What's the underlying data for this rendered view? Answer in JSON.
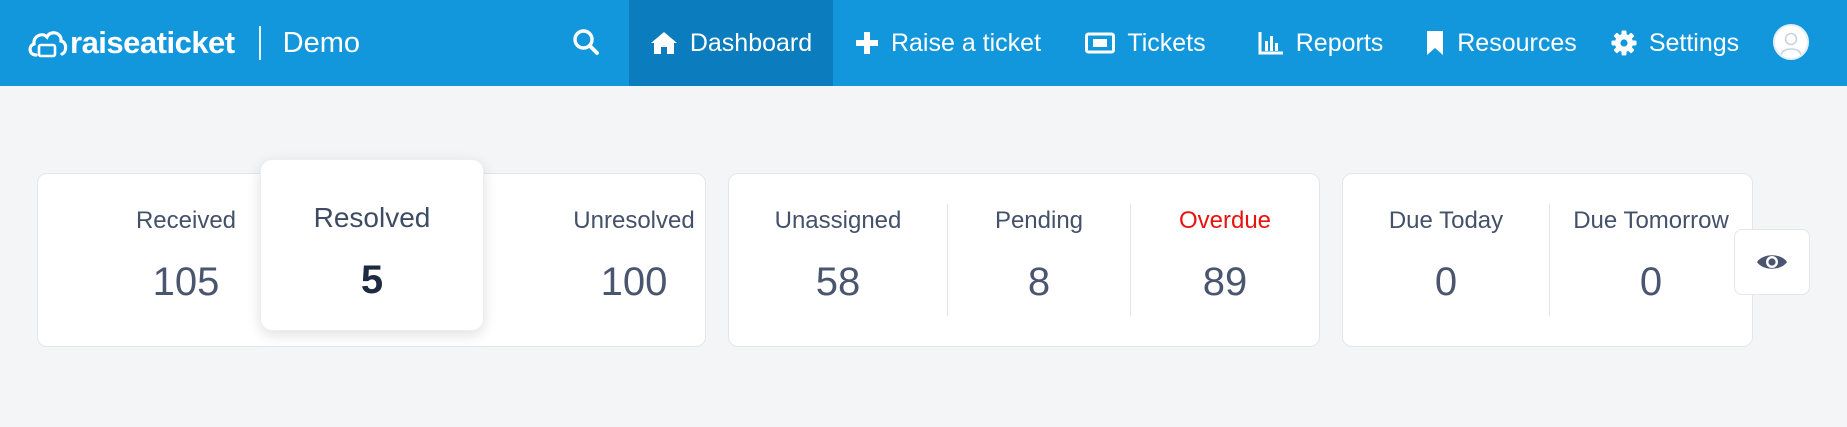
{
  "brand": {
    "name": "raiseaticket",
    "workspace": "Demo"
  },
  "nav": {
    "dashboard": "Dashboard",
    "raise_ticket": "Raise a ticket",
    "tickets": "Tickets",
    "reports": "Reports",
    "resources": "Resources",
    "settings": "Settings"
  },
  "stats": {
    "received": {
      "label": "Received",
      "value": "105"
    },
    "resolved": {
      "label": "Resolved",
      "value": "5"
    },
    "unresolved": {
      "label": "Unresolved",
      "value": "100"
    },
    "unassigned": {
      "label": "Unassigned",
      "value": "58"
    },
    "pending": {
      "label": "Pending",
      "value": "8"
    },
    "overdue": {
      "label": "Overdue",
      "value": "89"
    },
    "due_today": {
      "label": "Due Today",
      "value": "0"
    },
    "due_tomorrow": {
      "label": "Due Tomorrow",
      "value": "0"
    }
  },
  "colors": {
    "topbar": "#1297dd",
    "active_nav": "#0b7cbd",
    "overdue": "#e8130f"
  },
  "icons": {
    "logo": "cloud-ticket-icon",
    "search": "search-icon",
    "dashboard": "home-icon",
    "raise_ticket": "plus-icon",
    "tickets": "ticket-icon",
    "reports": "bar-chart-icon",
    "resources": "bookmark-icon",
    "settings": "gear-icon",
    "avatar": "user-icon",
    "toggle": "eye-icon"
  }
}
